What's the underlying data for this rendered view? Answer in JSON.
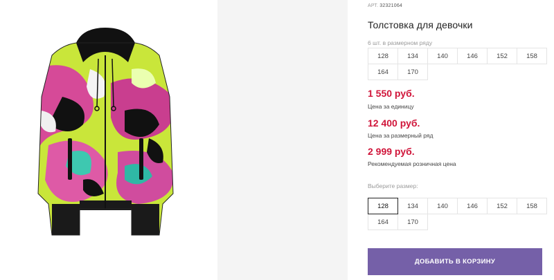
{
  "product": {
    "art_label": "АРТ.",
    "art_number": "32321064",
    "title": "Толстовка для девочки",
    "image_icon": "hoodie-product-image"
  },
  "size_row": {
    "note": "6 шт. в размерном ряду",
    "sizes": [
      "128",
      "134",
      "140",
      "146",
      "152",
      "158",
      "164",
      "170"
    ]
  },
  "prices": {
    "unit_price": "1 550 руб.",
    "unit_label": "Цена за единицу",
    "row_price": "12 400 руб.",
    "row_label": "Цена за размерный ряд",
    "retail_price": "2 999 руб.",
    "retail_label": "Рекомендуемая розничная цена"
  },
  "size_select": {
    "label": "Выберите размер:",
    "selected": "128",
    "options": [
      "128",
      "134",
      "140",
      "146",
      "152",
      "158",
      "164",
      "170"
    ]
  },
  "cart": {
    "add_label": "ДОБАВИТЬ В КОРЗИНУ"
  },
  "colors": {
    "price": "#d0153a",
    "button": "#7560a8"
  }
}
